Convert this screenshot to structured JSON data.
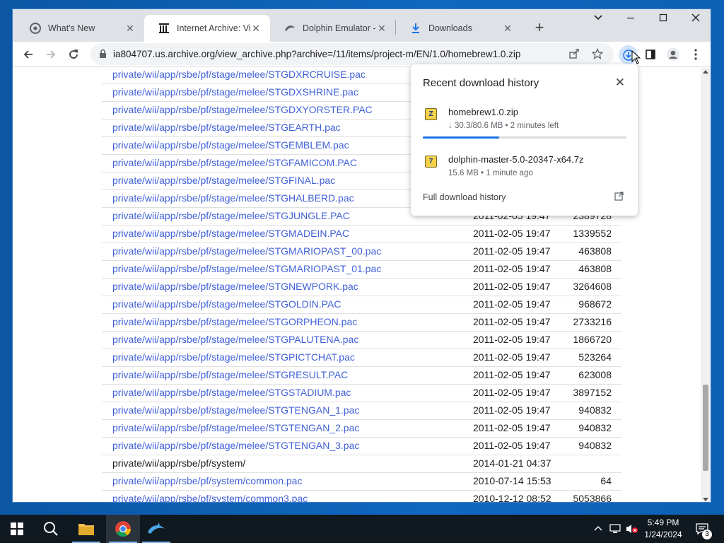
{
  "browser": {
    "tabs": [
      {
        "title": "What's New",
        "icon": "chrome-icon",
        "active": false
      },
      {
        "title": "Internet Archive: Vie",
        "icon": "archive-icon",
        "active": true
      },
      {
        "title": "Dolphin Emulator - D",
        "icon": "dolphin-icon",
        "active": false
      },
      {
        "title": "Downloads",
        "icon": "download-icon",
        "active": false
      }
    ],
    "url": "ia804707.us.archive.org/view_archive.php?archive=/11/items/project-m/EN/1.0/homebrew1.0.zip"
  },
  "downloads_popup": {
    "title": "Recent download history",
    "items": [
      {
        "file_icon": "Z",
        "name": "homebrew1.0.zip",
        "status": "↓ 30.3/80.6 MB • 2 minutes left",
        "progress": 0.376
      },
      {
        "file_icon": "7",
        "name": "dolphin-master-5.0-20347-x64.7z",
        "status": "15.6 MB • 1 minute ago"
      }
    ],
    "full_history_label": "Full download history"
  },
  "file_rows": [
    {
      "name": "private/wii/app/rsbe/pf/stage/melee/STGDXRCRUISE.pac",
      "date": "",
      "size": "",
      "link": true
    },
    {
      "name": "private/wii/app/rsbe/pf/stage/melee/STGDXSHRINE.pac",
      "date": "",
      "size": "",
      "link": true
    },
    {
      "name": "private/wii/app/rsbe/pf/stage/melee/STGDXYORSTER.PAC",
      "date": "",
      "size": "",
      "link": true
    },
    {
      "name": "private/wii/app/rsbe/pf/stage/melee/STGEARTH.pac",
      "date": "",
      "size": "",
      "link": true
    },
    {
      "name": "private/wii/app/rsbe/pf/stage/melee/STGEMBLEM.pac",
      "date": "",
      "size": "",
      "link": true
    },
    {
      "name": "private/wii/app/rsbe/pf/stage/melee/STGFAMICOM.PAC",
      "date": "",
      "size": "",
      "link": true
    },
    {
      "name": "private/wii/app/rsbe/pf/stage/melee/STGFINAL.pac",
      "date": "",
      "size": "",
      "link": true
    },
    {
      "name": "private/wii/app/rsbe/pf/stage/melee/STGHALBERD.pac",
      "date": "",
      "size": "",
      "link": true
    },
    {
      "name": "private/wii/app/rsbe/pf/stage/melee/STGJUNGLE.PAC",
      "date": "2011-02-05 19:47",
      "size": "2389728",
      "link": true
    },
    {
      "name": "private/wii/app/rsbe/pf/stage/melee/STGMADEIN.PAC",
      "date": "2011-02-05 19:47",
      "size": "1339552",
      "link": true
    },
    {
      "name": "private/wii/app/rsbe/pf/stage/melee/STGMARIOPAST_00.pac",
      "date": "2011-02-05 19:47",
      "size": "463808",
      "link": true
    },
    {
      "name": "private/wii/app/rsbe/pf/stage/melee/STGMARIOPAST_01.pac",
      "date": "2011-02-05 19:47",
      "size": "463808",
      "link": true
    },
    {
      "name": "private/wii/app/rsbe/pf/stage/melee/STGNEWPORK.pac",
      "date": "2011-02-05 19:47",
      "size": "3264608",
      "link": true
    },
    {
      "name": "private/wii/app/rsbe/pf/stage/melee/STGOLDIN.PAC",
      "date": "2011-02-05 19:47",
      "size": "968672",
      "link": true
    },
    {
      "name": "private/wii/app/rsbe/pf/stage/melee/STGORPHEON.pac",
      "date": "2011-02-05 19:47",
      "size": "2733216",
      "link": true
    },
    {
      "name": "private/wii/app/rsbe/pf/stage/melee/STGPALUTENA.pac",
      "date": "2011-02-05 19:47",
      "size": "1866720",
      "link": true
    },
    {
      "name": "private/wii/app/rsbe/pf/stage/melee/STGPICTCHAT.pac",
      "date": "2011-02-05 19:47",
      "size": "523264",
      "link": true
    },
    {
      "name": "private/wii/app/rsbe/pf/stage/melee/STGRESULT.PAC",
      "date": "2011-02-05 19:47",
      "size": "623008",
      "link": true
    },
    {
      "name": "private/wii/app/rsbe/pf/stage/melee/STGSTADIUM.pac",
      "date": "2011-02-05 19:47",
      "size": "3897152",
      "link": true
    },
    {
      "name": "private/wii/app/rsbe/pf/stage/melee/STGTENGAN_1.pac",
      "date": "2011-02-05 19:47",
      "size": "940832",
      "link": true
    },
    {
      "name": "private/wii/app/rsbe/pf/stage/melee/STGTENGAN_2.pac",
      "date": "2011-02-05 19:47",
      "size": "940832",
      "link": true
    },
    {
      "name": "private/wii/app/rsbe/pf/stage/melee/STGTENGAN_3.pac",
      "date": "2011-02-05 19:47",
      "size": "940832",
      "link": true
    },
    {
      "name": "private/wii/app/rsbe/pf/system/",
      "date": "2014-01-21 04:37",
      "size": "",
      "link": false
    },
    {
      "name": "private/wii/app/rsbe/pf/system/common.pac",
      "date": "2010-07-14 15:53",
      "size": "64",
      "link": true
    },
    {
      "name": "private/wii/app/rsbe/pf/system/common3.pac",
      "date": "2010-12-12 08:52",
      "size": "5053866",
      "link": true
    }
  ],
  "taskbar": {
    "apps": [
      "start-button",
      "search-button",
      "file-explorer",
      "chrome",
      "dolphin"
    ],
    "time": "5:49 PM",
    "date": "1/24/2024",
    "notification_count": "3"
  }
}
